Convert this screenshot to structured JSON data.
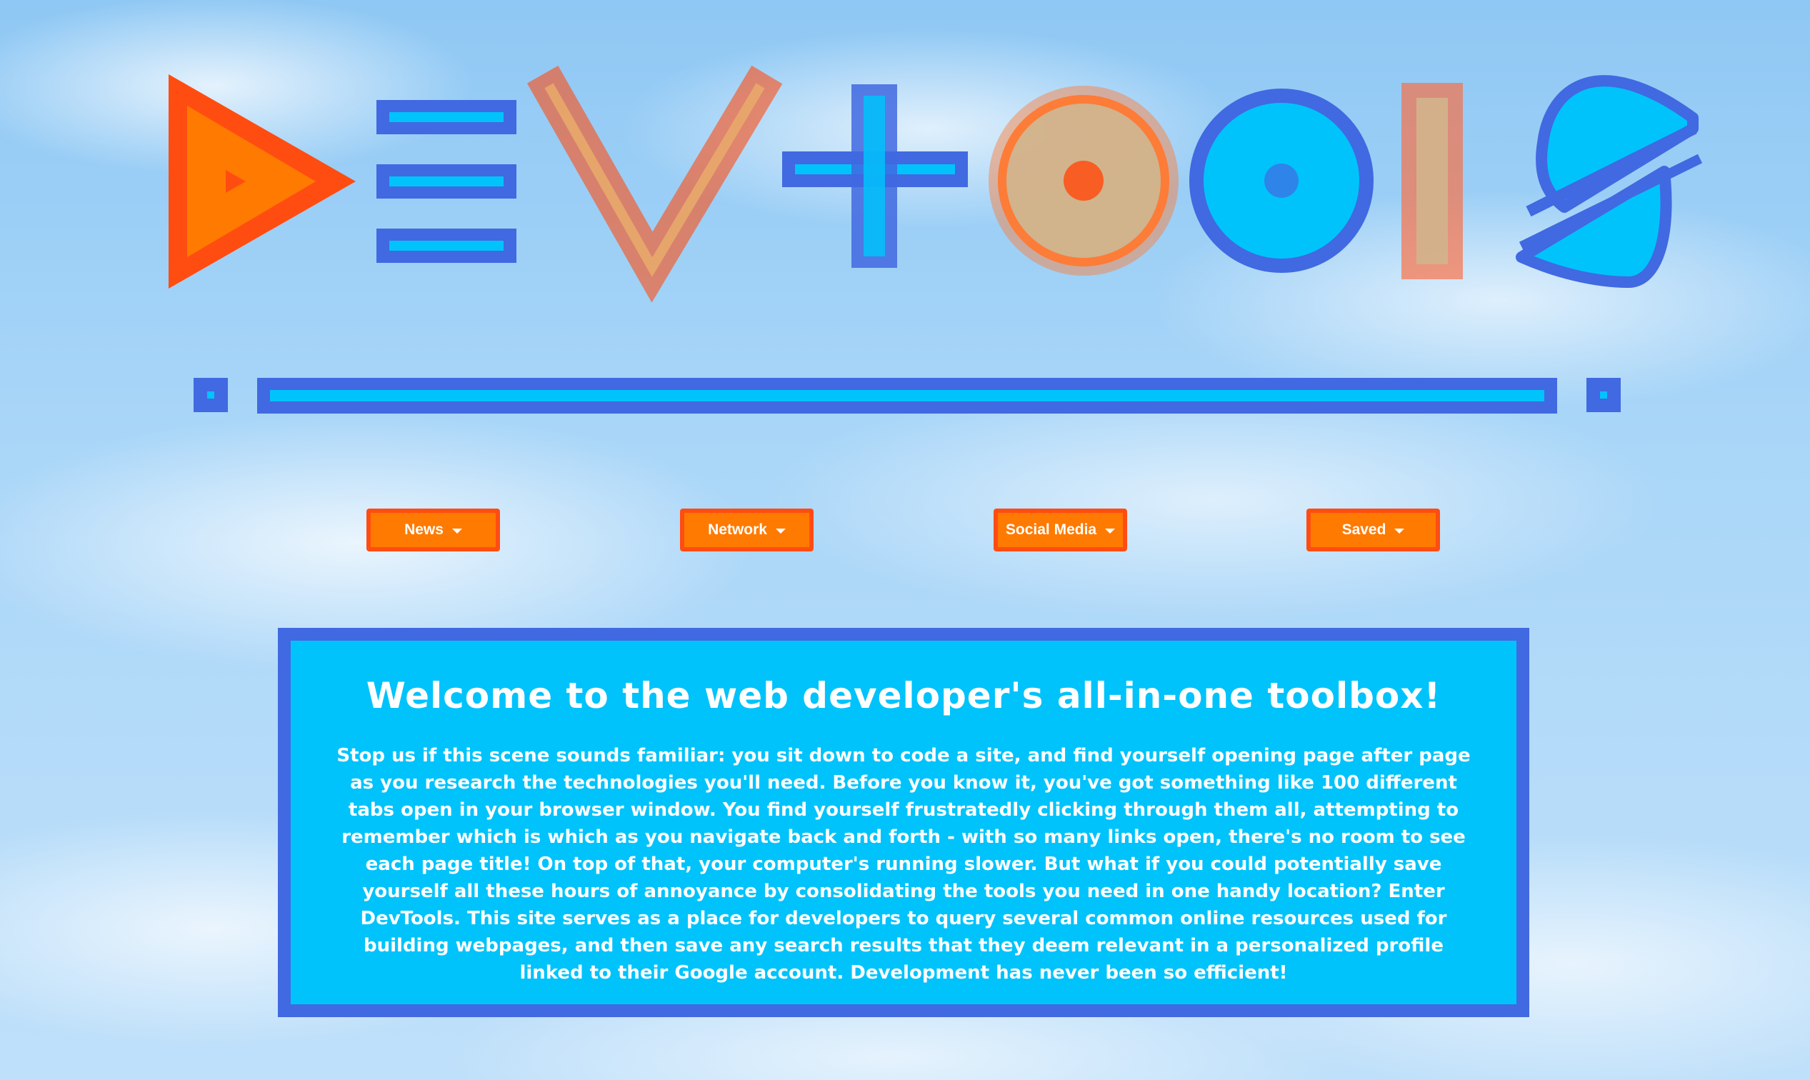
{
  "logo": {
    "letters": [
      "D",
      "E",
      "V",
      "+",
      "O",
      "O",
      "L",
      "S"
    ]
  },
  "colors": {
    "royal_blue": "#4169e1",
    "cyan": "#00c3fb",
    "orange": "#ff7a00",
    "orange_red": "#ff4d12",
    "tan": "#d2b48c"
  },
  "nav": {
    "items": [
      {
        "label": "News",
        "icon": "caret-down-icon"
      },
      {
        "label": "Network",
        "icon": "caret-down-icon"
      },
      {
        "label": "Social Media",
        "icon": "caret-down-icon"
      },
      {
        "label": "Saved",
        "icon": "caret-down-icon"
      }
    ]
  },
  "welcome": {
    "title": "Welcome to the web developer's all-in-one toolbox!",
    "body": "Stop us if this scene sounds familiar: you sit down to code a site, and find yourself opening page after page as you research the technologies you'll need. Before you know it, you've got something like 100 different tabs open in your browser window. You find yourself frustratedly clicking through them all, attempting to remember which is which as you navigate back and forth - with so many links open, there's no room to see each page title! On top of that, your computer's running slower. But what if you could potentially save yourself all these hours of annoyance by consolidating the tools you need in one handy location? Enter DevTools. This site serves as a place for developers to query several common online resources used for building webpages, and then save any search results that they deem relevant in a personalized profile linked to their Google account. Development has never been so efficient!"
  }
}
